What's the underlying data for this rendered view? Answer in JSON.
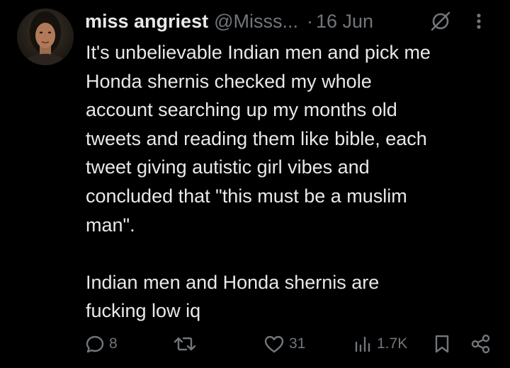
{
  "tweet": {
    "display_name": "miss angriest",
    "handle": "@Misss...",
    "separator": "·",
    "date": "16 Jun",
    "text": "It's unbelievable Indian men and pick me\nHonda shernis checked my whole\naccount searching up my months old\ntweets and reading them like bible, each\ntweet giving autistic girl vibes and\nconcluded that \"this must be a muslim\nman\".\n\nIndian men and Honda shernis are\nfucking low iq",
    "icons": {
      "avatar": "profile-photo",
      "grok": "grok-icon",
      "more": "more-options-icon"
    }
  },
  "actions": {
    "reply": {
      "icon": "reply-icon",
      "count": "8"
    },
    "repost": {
      "icon": "repost-icon",
      "count": ""
    },
    "like": {
      "icon": "heart-icon",
      "count": "31"
    },
    "views": {
      "icon": "views-icon",
      "count": "1.7K"
    },
    "bookmark": {
      "icon": "bookmark-icon"
    },
    "share": {
      "icon": "share-icon"
    }
  },
  "colors": {
    "background": "#000000",
    "primary_text": "#e7e9ea",
    "secondary_text": "#71767b"
  }
}
